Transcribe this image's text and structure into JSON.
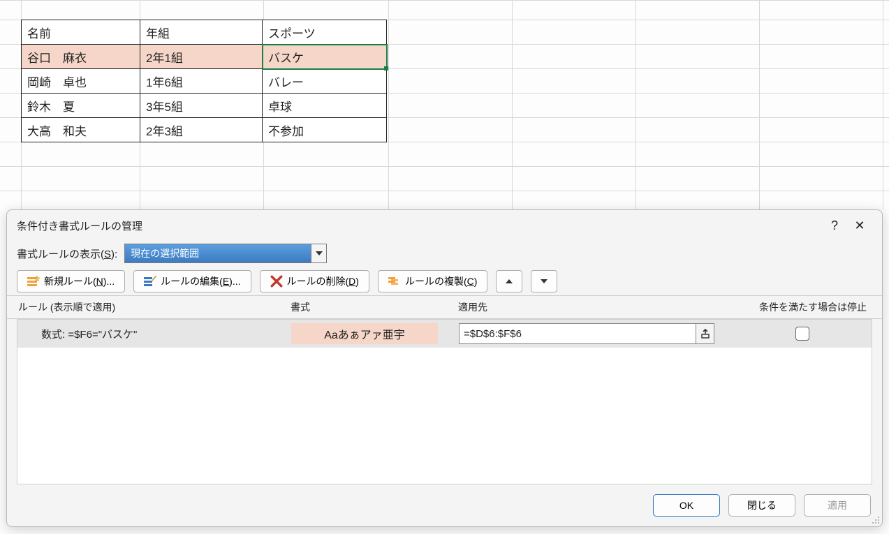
{
  "sheet": {
    "headers": [
      "名前",
      "年組",
      "スポーツ"
    ],
    "rows": [
      {
        "name": "谷口　麻衣",
        "class": "2年1組",
        "sport": "バスケ",
        "highlight": true
      },
      {
        "name": "岡崎　卓也",
        "class": "1年6組",
        "sport": "バレー",
        "highlight": false
      },
      {
        "name": "鈴木　夏",
        "class": "3年5組",
        "sport": "卓球",
        "highlight": false
      },
      {
        "name": "大高　和夫",
        "class": "2年3組",
        "sport": "不参加",
        "highlight": false
      }
    ]
  },
  "dialog": {
    "title": "条件付き書式ルールの管理",
    "help_glyph": "?",
    "close_glyph": "✕",
    "filter_label_pre": "書式ルールの表示(",
    "filter_label_key": "S",
    "filter_label_post": "):",
    "filter_value": "現在の選択範囲",
    "toolbar": {
      "new_pre": "新規ルール(",
      "new_key": "N",
      "new_post": ")...",
      "edit_pre": "ルールの編集(",
      "edit_key": "E",
      "edit_post": ")...",
      "del_pre": "ルールの削除(",
      "del_key": "D",
      "del_post": ")",
      "dup_pre": "ルールの複製(",
      "dup_key": "C",
      "dup_post": ")"
    },
    "columns": {
      "rule": "ルール (表示順で適用)",
      "format": "書式",
      "applies": "適用先",
      "stop": "条件を満たす場合は停止"
    },
    "rule": {
      "label": "数式: =$F6=\"バスケ\"",
      "preview": "Aaあぁアァ亜宇",
      "applies": "=$D$6:$F$6"
    },
    "footer": {
      "ok": "OK",
      "close": "閉じる",
      "apply": "適用"
    }
  },
  "colors": {
    "highlight_fill": "#f6d6c8",
    "active_border": "#1a7f45"
  }
}
